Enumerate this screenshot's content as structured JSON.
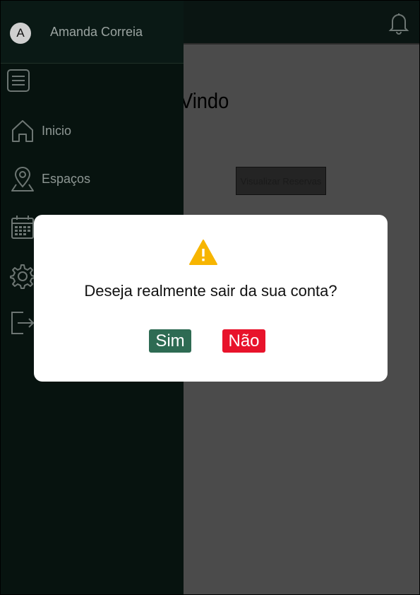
{
  "header": {
    "notification_icon": "bell-icon"
  },
  "main": {
    "welcome_text": "ja Bem-Vindo",
    "view_reservations_label": "Visualizar Reservas"
  },
  "drawer": {
    "user": {
      "avatar_initial": "A",
      "name": "Amanda Correia"
    },
    "menu_icon": "menu-icon",
    "items": [
      {
        "label": "Inicio",
        "icon": "home-icon"
      },
      {
        "label": "Espaços",
        "icon": "map-pin-icon"
      },
      {
        "label": "",
        "icon": "calendar-icon"
      },
      {
        "label": "",
        "icon": "gear-icon"
      },
      {
        "label": "",
        "icon": "logout-icon"
      }
    ]
  },
  "dialog": {
    "icon": "warning-icon",
    "message": "Deseja realmente sair da sua conta?",
    "yes_label": "Sim",
    "no_label": "Não",
    "colors": {
      "yes": "#2e6b53",
      "no": "#e8132b",
      "warning": "#f7b500"
    }
  }
}
